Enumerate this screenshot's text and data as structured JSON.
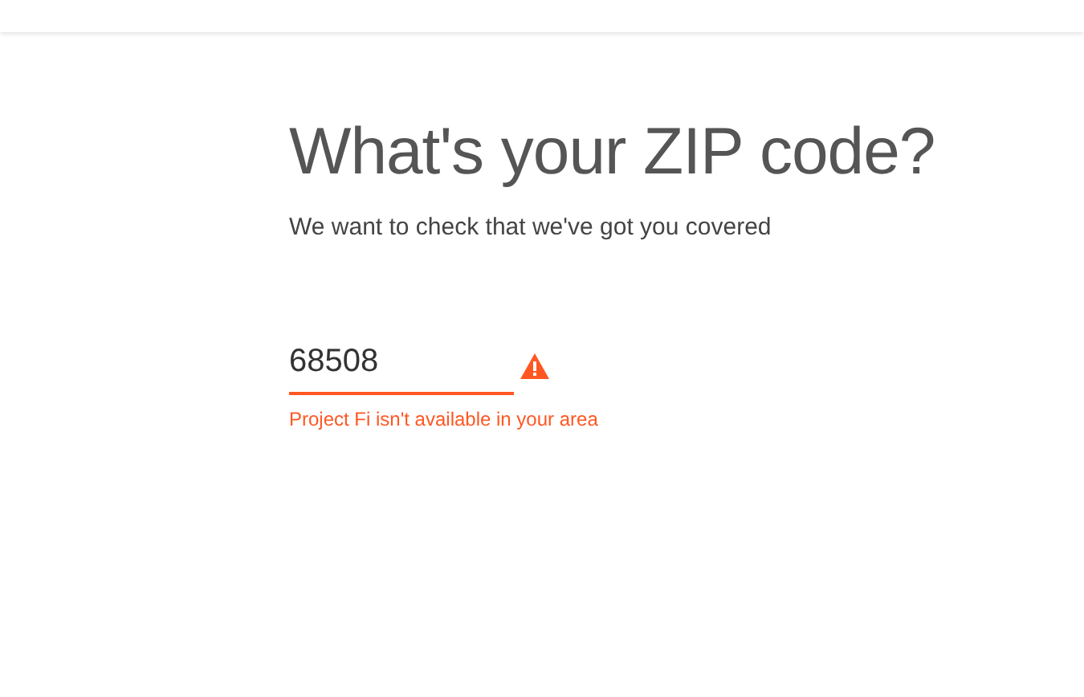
{
  "heading": "What's your ZIP code?",
  "subtitle": "We want to check that we've got you covered",
  "zip_field": {
    "value": "68508",
    "error": true,
    "error_message": "Project Fi isn't available in your area"
  }
}
